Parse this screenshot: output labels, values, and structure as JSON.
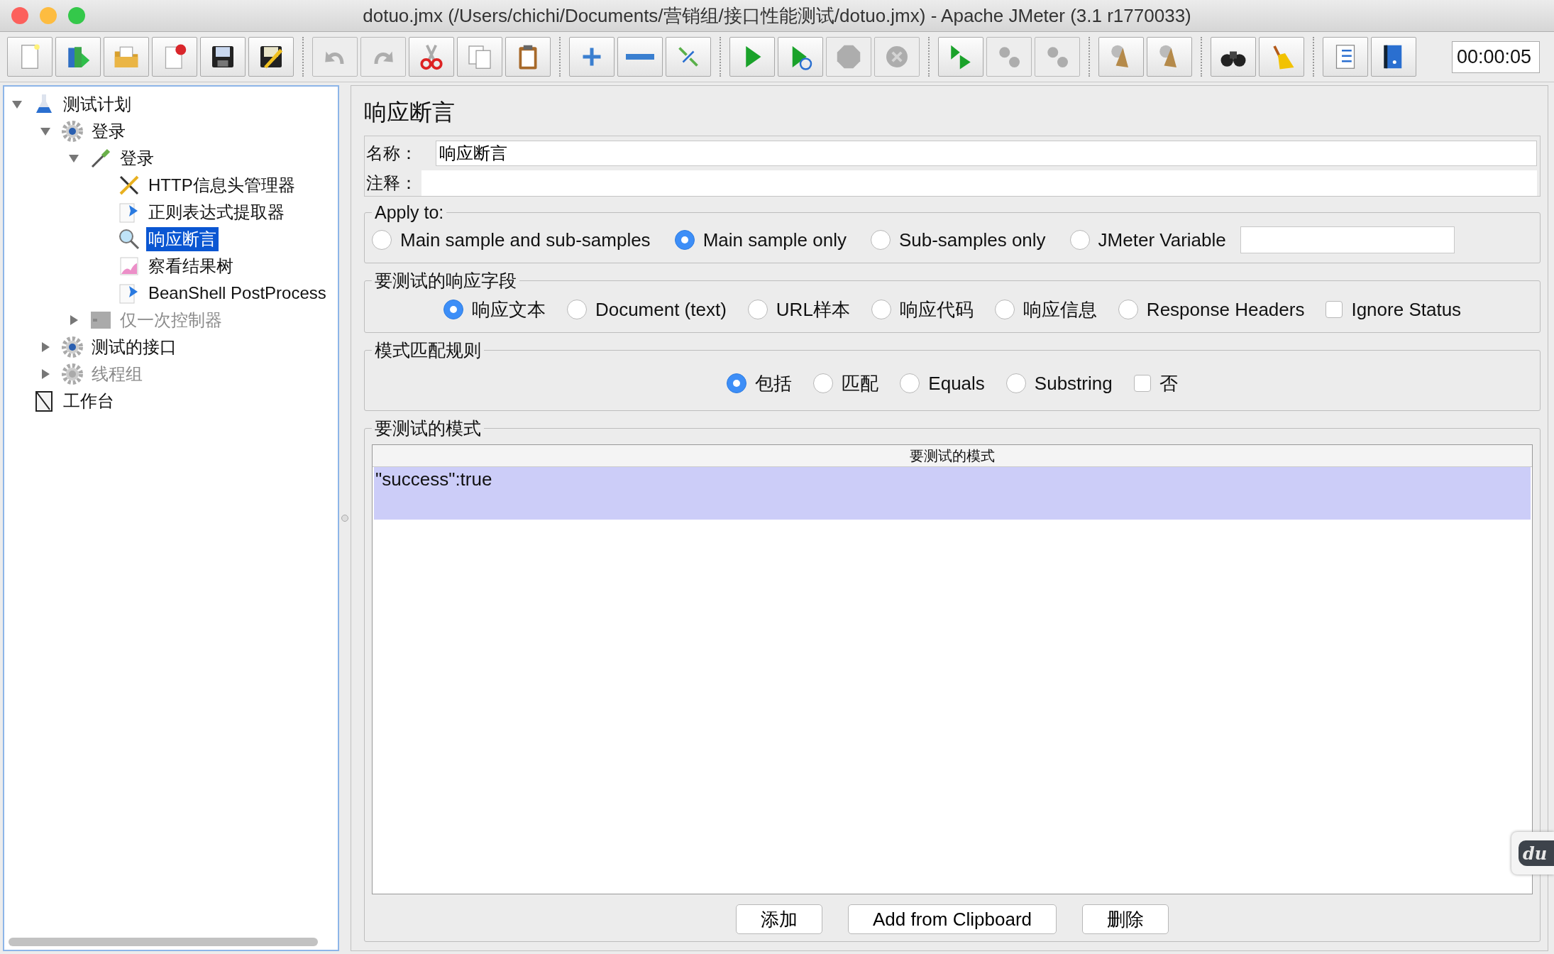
{
  "window": {
    "title": "dotuo.jmx (/Users/chichi/Documents/营销组/接口性能测试/dotuo.jmx) - Apache JMeter (3.1 r1770033)"
  },
  "toolbar": {
    "groups": [
      {
        "buttons": [
          {
            "kind": "new",
            "disabled": false
          },
          {
            "kind": "templates",
            "disabled": false
          },
          {
            "kind": "open",
            "disabled": false
          },
          {
            "kind": "close",
            "disabled": false
          },
          {
            "kind": "save",
            "disabled": false
          },
          {
            "kind": "save_image",
            "disabled": false
          }
        ]
      },
      {
        "buttons": [
          {
            "kind": "undo",
            "disabled": true
          },
          {
            "kind": "redo",
            "disabled": true
          },
          {
            "kind": "cut",
            "disabled": false
          },
          {
            "kind": "copy",
            "disabled": false
          },
          {
            "kind": "paste",
            "disabled": false
          }
        ]
      },
      {
        "buttons": [
          {
            "kind": "expand",
            "disabled": false
          },
          {
            "kind": "collapse",
            "disabled": false
          },
          {
            "kind": "toggle",
            "disabled": false
          }
        ]
      },
      {
        "buttons": [
          {
            "kind": "start",
            "disabled": false
          },
          {
            "kind": "start_no_pause",
            "disabled": false
          },
          {
            "kind": "stop",
            "disabled": true
          },
          {
            "kind": "shutdown",
            "disabled": true
          }
        ]
      },
      {
        "buttons": [
          {
            "kind": "remote_start",
            "disabled": false
          },
          {
            "kind": "remote_stop",
            "disabled": true
          },
          {
            "kind": "remote_shutdown",
            "disabled": true
          }
        ]
      },
      {
        "buttons": [
          {
            "kind": "clear",
            "disabled": false
          },
          {
            "kind": "clear_all",
            "disabled": false
          }
        ]
      },
      {
        "buttons": [
          {
            "kind": "search",
            "disabled": false
          },
          {
            "kind": "reset_search",
            "disabled": false
          }
        ]
      },
      {
        "buttons": [
          {
            "kind": "functions",
            "disabled": false
          },
          {
            "kind": "help",
            "disabled": false
          }
        ]
      }
    ],
    "timer": "00:00:05"
  },
  "tree": {
    "items": [
      {
        "kind": "plan",
        "label": "测试计划",
        "expanded": true,
        "selected": false,
        "disabled": false,
        "children": [
          {
            "kind": "gear",
            "label": "登录",
            "expanded": true,
            "selected": false,
            "disabled": false,
            "children": [
              {
                "kind": "sampler",
                "label": "登录",
                "expanded": true,
                "selected": false,
                "disabled": false,
                "children": [
                  {
                    "kind": "tools",
                    "label": "HTTP信息头管理器",
                    "selected": false,
                    "disabled": false
                  },
                  {
                    "kind": "extractor",
                    "label": "正则表达式提取器",
                    "selected": false,
                    "disabled": false
                  },
                  {
                    "kind": "assertion",
                    "label": "响应断言",
                    "selected": true,
                    "disabled": false
                  },
                  {
                    "kind": "listener",
                    "label": "察看结果树",
                    "selected": false,
                    "disabled": false
                  },
                  {
                    "kind": "extractor",
                    "label": "BeanShell PostProcess",
                    "selected": false,
                    "disabled": false
                  }
                ]
              },
              {
                "kind": "controller",
                "label": "仅一次控制器",
                "expanded": false,
                "selected": false,
                "disabled": true
              }
            ]
          },
          {
            "kind": "gear",
            "label": "测试的接口",
            "expanded": false,
            "selected": false,
            "disabled": false
          },
          {
            "kind": "gear",
            "label": "线程组",
            "expanded": false,
            "selected": false,
            "disabled": true
          }
        ]
      },
      {
        "kind": "workbench",
        "label": "工作台",
        "selected": false,
        "disabled": false
      }
    ]
  },
  "editor": {
    "title": "响应断言",
    "name_label": "名称：",
    "name_value": "响应断言",
    "comment_label": "注释：",
    "apply_to": {
      "title": "Apply to:",
      "options": [
        {
          "label": "Main sample and sub-samples",
          "selected": false
        },
        {
          "label": "Main sample only",
          "selected": true
        },
        {
          "label": "Sub-samples only",
          "selected": false
        },
        {
          "label": "JMeter Variable",
          "selected": false
        }
      ]
    },
    "response_field": {
      "title": "要测试的响应字段",
      "options": [
        {
          "kind": "radio",
          "label": "响应文本",
          "selected": true
        },
        {
          "kind": "radio",
          "label": "Document (text)",
          "selected": false
        },
        {
          "kind": "radio",
          "label": "URL样本",
          "selected": false
        },
        {
          "kind": "radio",
          "label": "响应代码",
          "selected": false
        },
        {
          "kind": "radio",
          "label": "响应信息",
          "selected": false
        },
        {
          "kind": "radio",
          "label": "Response Headers",
          "selected": false
        },
        {
          "kind": "checkbox",
          "label": "Ignore Status",
          "checked": false
        }
      ]
    },
    "pattern_rules": {
      "title": "模式匹配规则",
      "options": [
        {
          "kind": "radio",
          "label": "包括",
          "selected": true
        },
        {
          "kind": "radio",
          "label": "匹配",
          "selected": false
        },
        {
          "kind": "radio",
          "label": "Equals",
          "selected": false
        },
        {
          "kind": "radio",
          "label": "Substring",
          "selected": false
        },
        {
          "kind": "checkbox",
          "label": "否",
          "checked": false
        }
      ]
    },
    "patterns": {
      "title": "要测试的模式",
      "column": "要测试的模式",
      "rows": [
        {
          "text": "\"success\":true",
          "selected": true
        }
      ],
      "buttons": [
        "添加",
        "Add from Clipboard",
        "删除"
      ]
    }
  },
  "side_widget": {
    "label": "du"
  }
}
